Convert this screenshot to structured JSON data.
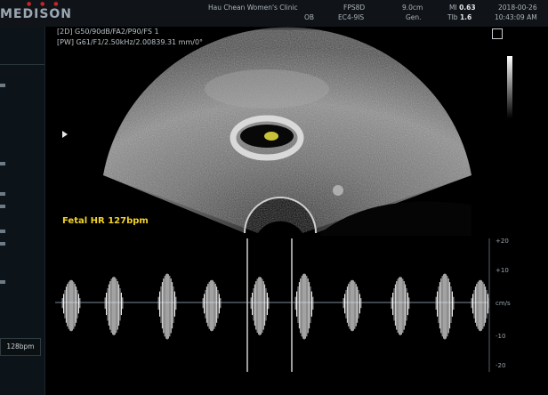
{
  "header": {
    "brand": "MEDISON",
    "clinic": "Hau Chean Women's Clinic",
    "dept": "OB",
    "probe_label": "FPS8D",
    "probe_sub": "EC4-9IS",
    "depth": "9.0cm",
    "gain": "Gen.",
    "mi_label": "MI",
    "mi_value": "0.63",
    "tib_label": "TIb",
    "tib_value": "1.6",
    "date": "2018-00-26",
    "time": "10:43:09 AM"
  },
  "params": {
    "mode_2d": "[2D] G50/90dB/FA2/P90/FS 1",
    "mode_pw": "[PW] G61/F1/2.50kHz/2.00839.31 mm/0°"
  },
  "measurement": {
    "fetal_hr": "Fetal HR 127bpm"
  },
  "sidebar": {
    "hr_box": "128bpm"
  },
  "scale": {
    "top": "+20",
    "mid_upper": "+10",
    "unit": "cm/s",
    "mid_lower": "-10",
    "bottom": "-20"
  },
  "colors": {
    "header_bg": "#101418",
    "measurement_text": "#f2d22a",
    "sidebar_bg": "#0c1419"
  }
}
